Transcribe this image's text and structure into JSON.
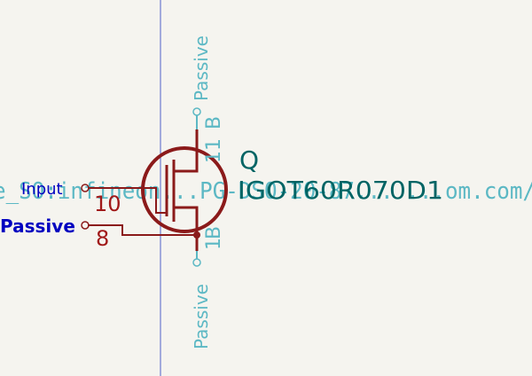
{
  "symbol": {
    "reference": "Q",
    "value": "IGOT60R070D1",
    "footprint_fragment": "e_SO:infineon...PG-DSO-20-87... ...om.com/"
  },
  "pins": {
    "gate": {
      "number": "10",
      "type": "Input"
    },
    "kelvin": {
      "number": "8",
      "type": "Passive"
    },
    "drain": {
      "number": "11",
      "type": "Passive",
      "stack_glyph": "B"
    },
    "source": {
      "number": "1",
      "type": "Passive",
      "stack_glyph": "B"
    }
  },
  "colors": {
    "background": "#f5f4ef",
    "symbol": "#8b1a1a",
    "pin_number": "#a01818",
    "pin_type": "#5cb8c4",
    "net_label": "#0000c0",
    "reference_text": "#006464",
    "guide_line": "#5060c8"
  }
}
